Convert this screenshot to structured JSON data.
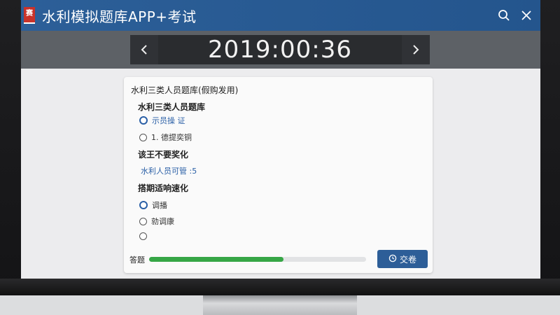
{
  "app": {
    "logo_text": "赛",
    "title": "水利模拟题库APP+考试"
  },
  "timer": {
    "value": "2019:00:36",
    "prev_glyph": "‹",
    "next_glyph": "›"
  },
  "question": {
    "title": "水利三类人员题库(假购发用)",
    "sections": [
      {
        "heading": "水利三类人员题库",
        "options": [
          {
            "label": "示员操 证",
            "selected": true
          },
          {
            "label": "1. 德提奕铜",
            "selected": false
          }
        ]
      },
      {
        "heading": "该王不要奖化",
        "options": [
          {
            "label": "水利人员可管 :5",
            "selected": false
          }
        ]
      },
      {
        "heading": "搭期适响速化",
        "options": [
          {
            "label": "调播",
            "selected": false
          },
          {
            "label": "勍调康",
            "selected": false
          },
          {
            "label": "",
            "selected": false
          }
        ]
      }
    ]
  },
  "footer": {
    "label": "答题",
    "progress": 0.62,
    "submit_label": "交卷"
  },
  "colors": {
    "titlebar": "#2c5f98",
    "progress": "#36a646",
    "submit": "#2d5e98"
  },
  "icons": [
    "search-icon",
    "close-icon",
    "chevron-left-icon",
    "chevron-right-icon",
    "clock-icon"
  ]
}
